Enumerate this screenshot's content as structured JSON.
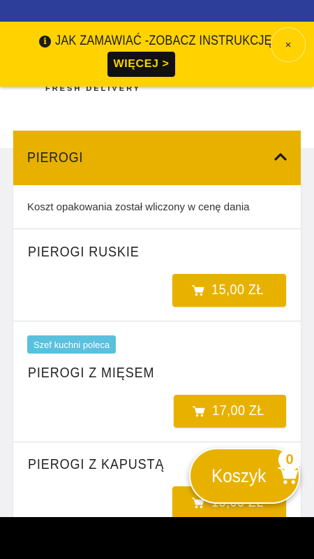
{
  "notice": {
    "text": "JAK ZAMAWIAĆ -ZOBACZ INSTRUKCJĘ",
    "more_label": "WIĘCEJ >",
    "close_label": "×"
  },
  "brand": {
    "tagline": "FRESH DELIVERY"
  },
  "category": {
    "title": "PIEROGI",
    "expanded": true,
    "packaging_note": "Koszt opakowania został wliczony w cenę dania"
  },
  "items": [
    {
      "name": "PIEROGI RUSKIE",
      "price": "15,00 ZŁ"
    },
    {
      "name": "PIEROGI Z MIĘSEM",
      "price": "17,00 ZŁ",
      "badge": "Szef kuchni poleca"
    },
    {
      "name": "PIEROGI Z KAPUSTĄ",
      "price": "15,00 ZŁ"
    }
  ],
  "basket": {
    "label": "Koszyk",
    "count": "0"
  },
  "icons": {
    "info": "info-icon",
    "close": "close-icon",
    "chevron": "chevron-up-icon",
    "cart": "cart-icon"
  },
  "colors": {
    "status_bar": "#2c3e99",
    "notice_bg": "#ffd200",
    "accent": "#e8b100",
    "badge": "#5bc0de"
  }
}
